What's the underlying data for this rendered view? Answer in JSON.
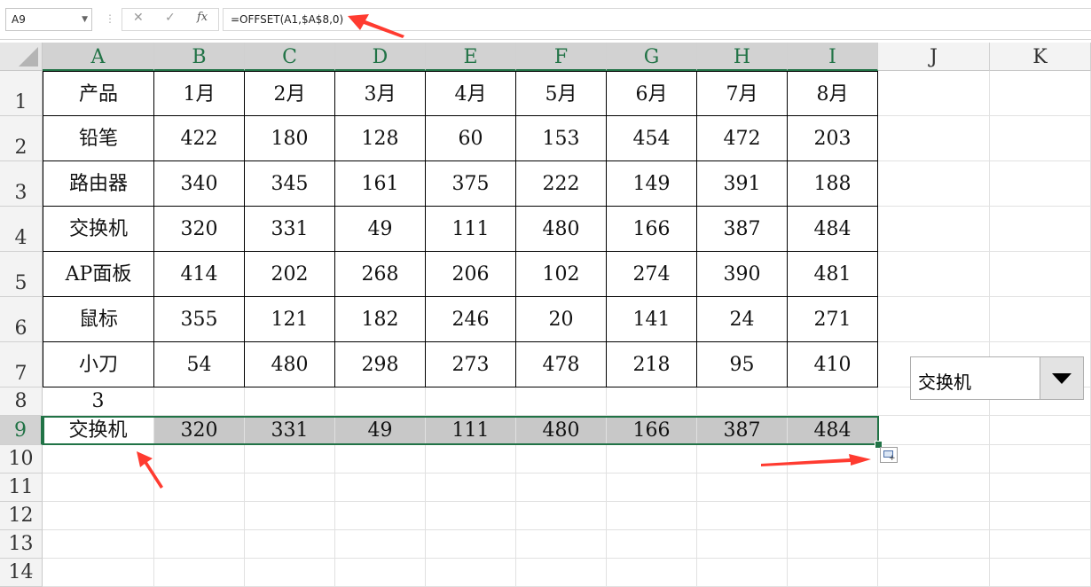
{
  "formula_bar": {
    "name_box": "A9",
    "cancel_icon": "✕",
    "enter_icon": "✓",
    "fx_label": "fx",
    "formula": "=OFFSET(A1,$A$8,0)"
  },
  "columns": [
    "A",
    "B",
    "C",
    "D",
    "E",
    "F",
    "G",
    "H",
    "I",
    "J",
    "K"
  ],
  "selected_columns": [
    "A",
    "B",
    "C",
    "D",
    "E",
    "F",
    "G",
    "H",
    "I"
  ],
  "rows": [
    "1",
    "2",
    "3",
    "4",
    "5",
    "6",
    "7",
    "8",
    "9",
    "10",
    "11",
    "12",
    "13",
    "14"
  ],
  "selected_row": "9",
  "table": {
    "header": [
      "产品",
      "1月",
      "2月",
      "3月",
      "4月",
      "5月",
      "6月",
      "7月",
      "8月"
    ],
    "body": [
      [
        "铅笔",
        "422",
        "180",
        "128",
        "60",
        "153",
        "454",
        "472",
        "203"
      ],
      [
        "路由器",
        "340",
        "345",
        "161",
        "375",
        "222",
        "149",
        "391",
        "188"
      ],
      [
        "交换机",
        "320",
        "331",
        "49",
        "111",
        "480",
        "166",
        "387",
        "484"
      ],
      [
        "AP面板",
        "414",
        "202",
        "268",
        "206",
        "102",
        "274",
        "390",
        "481"
      ],
      [
        "鼠标",
        "355",
        "121",
        "182",
        "246",
        "20",
        "141",
        "24",
        "271"
      ],
      [
        "小刀",
        "54",
        "480",
        "298",
        "273",
        "478",
        "218",
        "95",
        "410"
      ]
    ]
  },
  "row8": {
    "a8": "3"
  },
  "row9": [
    "交换机",
    "320",
    "331",
    "49",
    "111",
    "480",
    "166",
    "387",
    "484"
  ],
  "combo_box": {
    "value": "交换机"
  },
  "colors": {
    "selection": "#217346",
    "highlight": "#c8c8c8",
    "annotation": "#ff3b30"
  }
}
